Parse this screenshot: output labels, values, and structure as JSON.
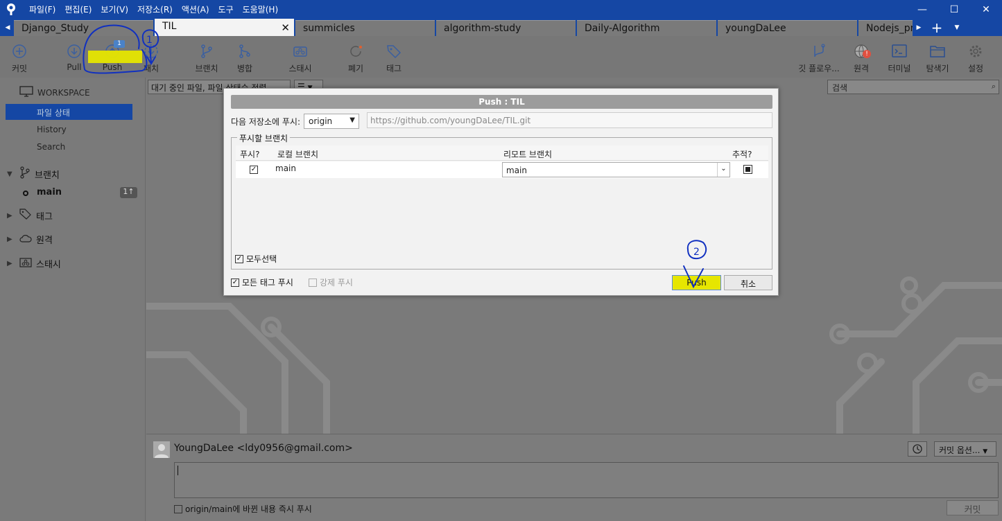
{
  "app": {
    "menu": [
      "파일(F)",
      "편집(E)",
      "보기(V)",
      "저장소(R)",
      "액션(A)",
      "도구",
      "도움말(H)"
    ]
  },
  "tabs": [
    {
      "label": "Django_Study"
    },
    {
      "label": "TIL",
      "active": true
    },
    {
      "label": "summicles"
    },
    {
      "label": "algorithm-study"
    },
    {
      "label": "Daily-Algorithm"
    },
    {
      "label": "youngDaLee"
    },
    {
      "label": "Nodejs_pr"
    }
  ],
  "toolbar": {
    "commit": "커밋",
    "pull": "Pull",
    "push": "Push",
    "push_badge": "1",
    "fetch": "패치",
    "branch": "브랜치",
    "merge": "병합",
    "stash": "스태시",
    "discard": "폐기",
    "tag": "태그",
    "git_flow": "깃 플로우...",
    "remote": "원격",
    "terminal": "터미널",
    "explorer": "탐색기",
    "settings": "설정"
  },
  "sidebar": {
    "workspace": "WORKSPACE",
    "items": [
      "파일 상태",
      "History",
      "Search"
    ],
    "selected": "파일 상태",
    "branches": "브랜치",
    "current_branch": "main",
    "ahead_badge": "1↑",
    "tags": "태그",
    "remotes": "원격",
    "stashes": "스태시"
  },
  "main": {
    "filter": "대기 중인 파일, 파일 상태순 정렬",
    "view_toggle": "☰",
    "search_placeholder": "검색"
  },
  "commit_area": {
    "author": "YoungDaLee <ldy0956@gmail.com>",
    "options": "커밋 옵션...",
    "push_immediately": "origin/main에 바뀐 내용 즉시 푸시",
    "commit_button": "커밋"
  },
  "dialog": {
    "title": "Push : TIL",
    "push_to_label": "다음 저장소에 푸시:",
    "remote": "origin",
    "remote_url": "https://github.com/youngDaLee/TIL.git",
    "branches_group": "푸시할 브랜치",
    "columns": [
      "푸시?",
      "로컬 브랜치",
      "리모트 브랜치",
      "추적?"
    ],
    "rows": [
      {
        "push": true,
        "local": "main",
        "remote": "main",
        "track": true
      }
    ],
    "select_all": "모두선택",
    "push_all_tags": "모든 태그 푸시",
    "force_push": "강제 푸시",
    "push_button": "Push",
    "cancel_button": "취소"
  },
  "annotations": {
    "step1": "1",
    "step2": "2",
    "highlight_color": "#e6e600",
    "pen_color": "#1030c0"
  }
}
